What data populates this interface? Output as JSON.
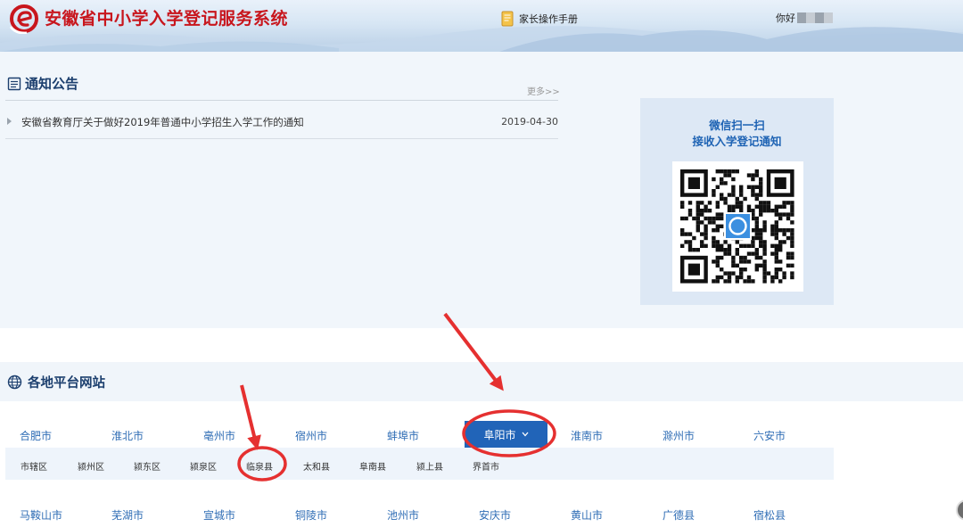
{
  "header": {
    "title": "安徽省中小学入学登记服务系统",
    "manual_label": "家长操作手册",
    "greeting": "你好"
  },
  "notice": {
    "title": "通知公告",
    "more": "更多>>",
    "items": [
      {
        "text": "安徽省教育厅关于做好2019年普通中小学招生入学工作的通知",
        "date": "2019-04-30"
      }
    ]
  },
  "qr": {
    "line1": "微信扫一扫",
    "line2": "接收入学登记通知"
  },
  "platform": {
    "title": "各地平台网站",
    "row1": [
      "合肥市",
      "淮北市",
      "亳州市",
      "宿州市",
      "蚌埠市",
      "阜阳市",
      "淮南市",
      "滁州市",
      "六安市"
    ],
    "active_city": "阜阳市",
    "counties": [
      "市辖区",
      "颍州区",
      "颍东区",
      "颍泉区",
      "临泉县",
      "太和县",
      "阜南县",
      "颍上县",
      "界首市"
    ],
    "row2": [
      "马鞍山市",
      "芜湖市",
      "宣城市",
      "铜陵市",
      "池州市",
      "安庆市",
      "黄山市",
      "广德县",
      "宿松县"
    ]
  },
  "colors": {
    "brand_red": "#c8161d",
    "title_blue": "#1c3f6e",
    "link_blue": "#2f6db5",
    "active_blue": "#2164b8",
    "annotation_red": "#e53030"
  }
}
